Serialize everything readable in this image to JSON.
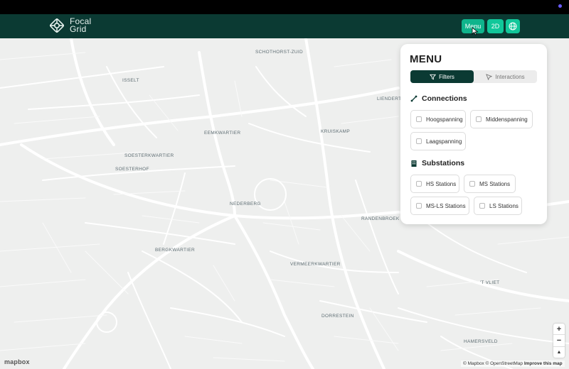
{
  "header": {
    "logo_line1": "Focal",
    "logo_line2": "Grid",
    "menu_button": "Menu",
    "view_button": "2D",
    "globe_icon": "globe-icon"
  },
  "panel": {
    "title": "MENU",
    "tabs": [
      {
        "label": "Filters",
        "icon": "filter-icon",
        "active": true
      },
      {
        "label": "Interactions",
        "icon": "pointer-icon",
        "active": false
      }
    ],
    "connections": {
      "title": "Connections",
      "icon": "connection-icon",
      "items": [
        "Hoogspanning",
        "Middenspanning",
        "Laagspanning"
      ]
    },
    "substations": {
      "title": "Substations",
      "icon": "substation-icon",
      "items": [
        "HS Stations",
        "MS Stations",
        "MS-LS Stations",
        "LS Stations"
      ]
    }
  },
  "map": {
    "labels": [
      "SCHOTHORST-ZUID",
      "ISSELT",
      "LIENDERT",
      "EEMKWARTIER",
      "KRUISKAMP",
      "SOESTERKWARTIER",
      "SOESTERHOF",
      "NEDERBERG",
      "RANDENBROEK",
      "BERGKWARTIER",
      "VERMEERKWARTIER",
      "DORRESTEIN",
      "'T VLIET",
      "HAMERSVELD"
    ],
    "zoom_in": "+",
    "zoom_out": "−",
    "compass": "▲",
    "brand": "mapbox",
    "attribution": "© Mapbox © OpenStreetMap",
    "improve": "Improve this map"
  },
  "colors": {
    "header_bg": "#0b3a33",
    "accent": "#11c79a",
    "map_bg": "#eeefee"
  }
}
